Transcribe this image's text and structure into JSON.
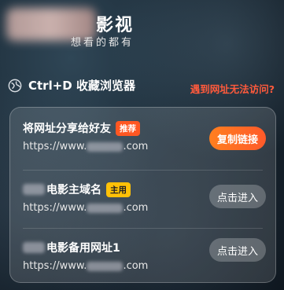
{
  "header": {
    "brand_name": "影视",
    "slogan": "想看的都有"
  },
  "bookmark_hint": {
    "text": "Ctrl+D 收藏浏览器",
    "icon": "globe-icon"
  },
  "unreachable_link": "遇到网址无法访问?",
  "card": {
    "rows": [
      {
        "title": "将网址分享给好友",
        "badge": "推荐",
        "url_prefix": "https://www.",
        "url_suffix": ".com",
        "button": "复制链接"
      },
      {
        "title": "电影主域名",
        "badge": "主用",
        "url_prefix": "https://www.",
        "url_suffix": ".com",
        "button": "点击进入"
      },
      {
        "title": "电影备用网址1",
        "url_prefix": "https://www.",
        "url_suffix": ".com",
        "button": "点击进入"
      }
    ]
  },
  "colors": {
    "accent_orange": "#ff5722",
    "badge_yellow": "#ffc107",
    "warning_red": "#ff5a3c"
  }
}
